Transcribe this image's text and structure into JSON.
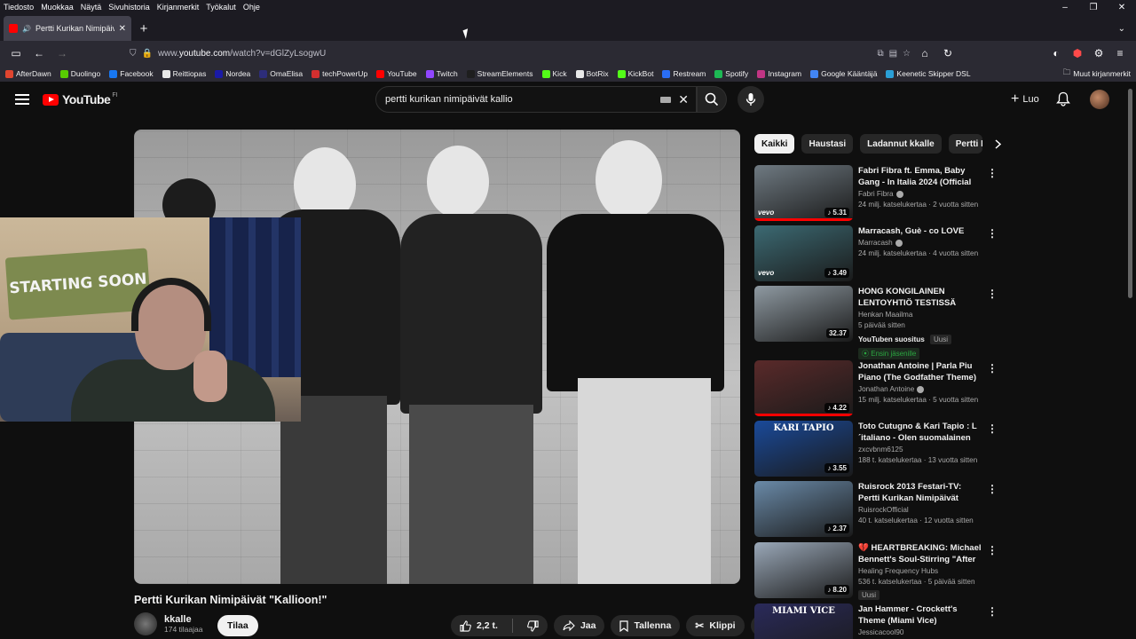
{
  "menubar": [
    "Tiedosto",
    "Muokkaa",
    "Näytä",
    "Sivuhistoria",
    "Kirjanmerkit",
    "Työkalut",
    "Ohje"
  ],
  "tab": {
    "title": "Pertti Kurikan Nimipäivät \"K"
  },
  "url": {
    "prefix": "www.",
    "host": "youtube.com",
    "path": "/watch?v=dGlZyLsogwU"
  },
  "bookmarks": [
    "AfterDawn",
    "Duolingo",
    "Facebook",
    "Reittiopas",
    "Nordea",
    "OmaElisa",
    "techPowerUp",
    "YouTube",
    "Twitch",
    "StreamElements",
    "Kick",
    "BotRix",
    "KickBot",
    "Restream",
    "Spotify",
    "Instagram",
    "Google Kääntäjä",
    "Keenetic Skipper DSL"
  ],
  "bookmarks_other": "Muut kirjanmerkit",
  "bookmark_colors": [
    "#e0452f",
    "#58cc02",
    "#1877f2",
    "#e8e8e8",
    "#1a1aa6",
    "#2d2d7a",
    "#d32f2f",
    "#ff0000",
    "#9146ff",
    "#1e1e1e",
    "#53fc18",
    "#e8e8e8",
    "#53fc18",
    "#2a6df4",
    "#1db954",
    "#c13584",
    "#4285f4",
    "#2a9fd6"
  ],
  "yt": {
    "logo": "YouTube",
    "region": "FI",
    "search_query": "pertti kurikan nimipäivät kallio",
    "create_label": "Luo"
  },
  "video": {
    "title": "Pertti Kurikan Nimipäivät \"Kallioon!\"",
    "channel": "kkalle",
    "subscribers": "174 tilaajaa",
    "subscribe_label": "Tilaa",
    "likes": "2,2 t.",
    "share_label": "Jaa",
    "save_label": "Tallenna",
    "clip_label": "Klippi",
    "webcam_poster": "STARTING SOON"
  },
  "chips": [
    "Kaikki",
    "Haustasi",
    "Ladannut kkalle",
    "Pertti K"
  ],
  "recs": [
    {
      "title": "Fabri Fibra ft. Emma, Baby Gang - In Italia 2024 (Official Video)",
      "channel": "Fabri Fibra",
      "verified": true,
      "meta": "24 milj. katselukertaa · 2 vuotta sitten",
      "duration": "5.31",
      "music": true,
      "progress": 1.0,
      "vevo": true,
      "color": "#6f7a82"
    },
    {
      "title": "Marracash, Guè - co LOVE",
      "channel": "Marracash",
      "verified": true,
      "meta": "24 milj. katselukertaa · 4 vuotta sitten",
      "duration": "3.49",
      "music": true,
      "progress": 0,
      "vevo": true,
      "color": "#3c6a73"
    },
    {
      "title": "HONG KONGILAINEN LENTOYHTIÖ TESTISSÄ",
      "channel": "Henkan Maailma",
      "verified": false,
      "meta": "5 päivää sitten",
      "extra": "YouTuben suositus",
      "badge": "Uusi",
      "members": "Ensin jäsenille",
      "duration": "32.37",
      "music": false,
      "progress": 0,
      "vevo": false,
      "color": "#8f9aa2"
    },
    {
      "title": "Jonathan Antoine | Parla Piu Piano (The Godfather Theme)",
      "channel": "Jonathan Antoine",
      "verified": true,
      "meta": "15 milj. katselukertaa · 5 vuotta sitten",
      "duration": "4.22",
      "music": true,
      "progress": 1.0,
      "vevo": false,
      "color": "#5a2a2a"
    },
    {
      "title": "Toto Cutugno & Kari Tapio : L´italiano - Olen suomalainen",
      "channel": "zxcvbnm6125",
      "verified": false,
      "meta": "188 t. katselukertaa · 13 vuotta sitten",
      "duration": "3.55",
      "music": true,
      "progress": 0,
      "vevo": false,
      "color": "#1a4a9a",
      "thumb_text": "KARI TAPIO"
    },
    {
      "title": "Ruisrock 2013 Festari-TV: Pertti Kurikan Nimipäivät",
      "channel": "RuisrockOfficial",
      "verified": false,
      "meta": "40 t. katselukertaa · 12 vuotta sitten",
      "duration": "2.37",
      "music": true,
      "progress": 0,
      "vevo": false,
      "color": "#6a8aa8"
    },
    {
      "title": "💔 HEARTBREAKING: Michael Bennett's Soul-Stirring \"After I...",
      "channel": "Healing Frequency Hubs",
      "verified": false,
      "meta": "536 t. katselukertaa · 5 päivää sitten",
      "badge": "Uusi",
      "duration": "8.20",
      "music": true,
      "progress": 0,
      "vevo": false,
      "color": "#9aa8b8"
    },
    {
      "title": "Jan Hammer - Crockett's Theme (Miami Vice)",
      "channel": "Jessicacool90",
      "verified": false,
      "meta": "",
      "duration": "",
      "music": false,
      "progress": 0,
      "vevo": false,
      "color": "#2a2a5a",
      "thumb_text": "MIAMI VICE"
    }
  ]
}
